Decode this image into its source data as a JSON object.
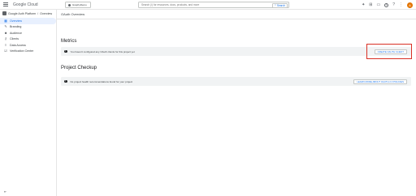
{
  "topbar": {
    "brand": "Google Cloud",
    "project": "GraphyDemo",
    "search_placeholder": "Search (/) for resources, docs, products, and more",
    "search_button": "Search",
    "avatar_initial": "A",
    "badge_count": "1"
  },
  "breadcrumb": {
    "platform": "Google Auth Platform",
    "separator": "/",
    "current": "Overview"
  },
  "sidebar": {
    "items": [
      {
        "label": "Overview",
        "icon": "grid-icon"
      },
      {
        "label": "Branding",
        "icon": "brush-icon"
      },
      {
        "label": "Audience",
        "icon": "people-icon"
      },
      {
        "label": "Clients",
        "icon": "key-icon"
      },
      {
        "label": "Data Access",
        "icon": "database-icon"
      },
      {
        "label": "Verification Center",
        "icon": "checklist-icon"
      }
    ],
    "active_index": 0
  },
  "main": {
    "page_title": "OAuth Overview",
    "metrics": {
      "title": "Metrics",
      "message": "You haven't configured any OAuth clients for this project yet",
      "button": "CREATE OAUTH CLIENT"
    },
    "checkup": {
      "title": "Project Checkup",
      "message": "No project health recommendations found for your project",
      "button": "LEARN MORE ABOUT OAUTH 2.0 POLICIES"
    }
  },
  "colors": {
    "accent": "#1a73e8",
    "highlight": "#d93025",
    "card_bg": "#f1f3f4",
    "active_nav_bg": "#e8f0fe",
    "avatar_bg": "#e37400"
  }
}
